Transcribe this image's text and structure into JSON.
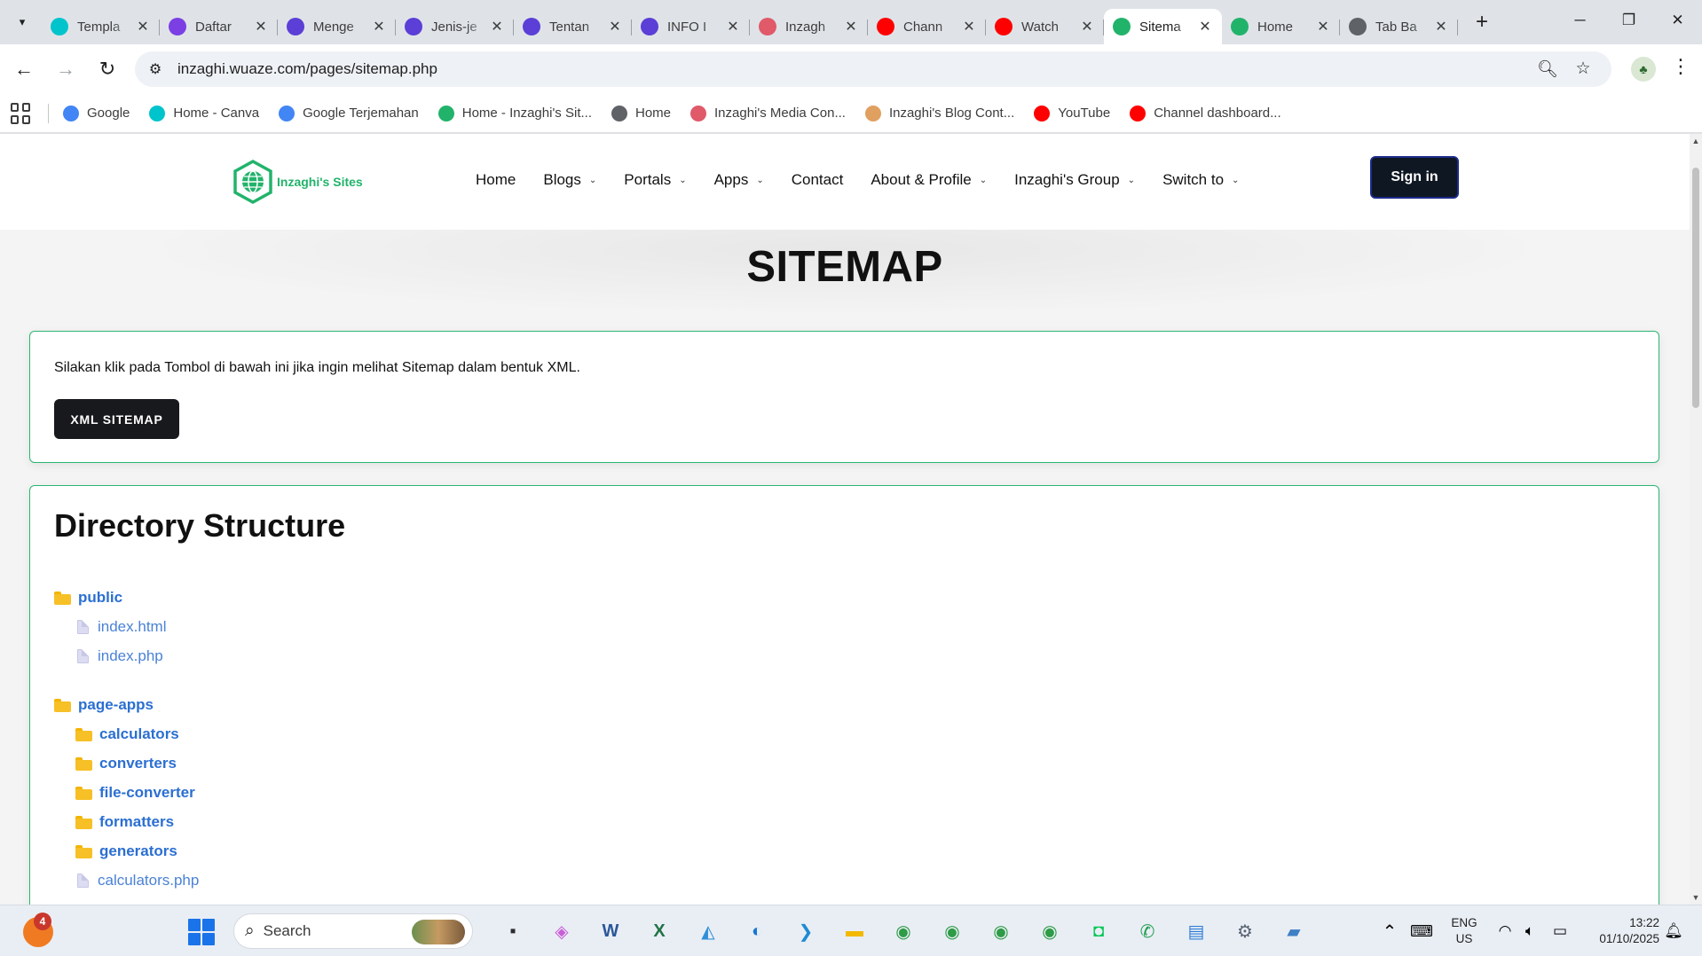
{
  "browser": {
    "tabs": [
      {
        "title": "Templa",
        "icon": "canva-icon",
        "color": "#00c4cc"
      },
      {
        "title": "Daftar",
        "icon": "video-icon",
        "color": "#7b3fe4"
      },
      {
        "title": "Menge",
        "icon": "shield-heart-icon",
        "color": "#5b3fd6"
      },
      {
        "title": "Jenis-je",
        "icon": "shield-heart-icon",
        "color": "#5b3fd6"
      },
      {
        "title": "Tentan",
        "icon": "shield-heart-icon",
        "color": "#5b3fd6"
      },
      {
        "title": "INFO I",
        "icon": "shield-heart-icon",
        "color": "#5b3fd6"
      },
      {
        "title": "Inzagh",
        "icon": "media-icon",
        "color": "#e05a6a"
      },
      {
        "title": "Chann",
        "icon": "youtube-icon",
        "color": "#ff0000"
      },
      {
        "title": "Watch",
        "icon": "youtube-icon",
        "color": "#ff0000"
      },
      {
        "title": "Sitema",
        "icon": "globe-icon",
        "color": "#22b36b",
        "active": true
      },
      {
        "title": "Home",
        "icon": "globe-icon",
        "color": "#22b36b"
      },
      {
        "title": "Tab Ba",
        "icon": "chrome-icon",
        "color": "#5f6368"
      }
    ],
    "url": "inzaghi.wuaze.com/pages/sitemap.php",
    "bookmarks": [
      {
        "label": "Google",
        "color": "#4285f4"
      },
      {
        "label": "Home - Canva",
        "color": "#00c4cc"
      },
      {
        "label": "Google Terjemahan",
        "color": "#4285f4"
      },
      {
        "label": "Home - Inzaghi's Sit...",
        "color": "#22b36b"
      },
      {
        "label": "Home",
        "color": "#5f6368"
      },
      {
        "label": "Inzaghi's Media Con...",
        "color": "#e05a6a"
      },
      {
        "label": "Inzaghi's Blog Cont...",
        "color": "#e0a060"
      },
      {
        "label": "YouTube",
        "color": "#ff0000"
      },
      {
        "label": "Channel dashboard...",
        "color": "#ff0000"
      }
    ]
  },
  "site": {
    "brand": "Inzaghi's Sites",
    "nav": [
      {
        "label": "Home",
        "dropdown": false
      },
      {
        "label": "Blogs",
        "dropdown": true
      },
      {
        "label": "Portals",
        "dropdown": true
      },
      {
        "label": "Apps",
        "dropdown": true
      },
      {
        "label": "Contact",
        "dropdown": false
      },
      {
        "label": "About & Profile",
        "dropdown": true
      },
      {
        "label": "Inzaghi's Group",
        "dropdown": true
      },
      {
        "label": "Switch to",
        "dropdown": true
      }
    ],
    "signin_label": "Sign in",
    "accent": "#2bb673"
  },
  "page": {
    "title": "SITEMAP",
    "xml_card": {
      "text": "Silakan klik pada Tombol di bawah ini jika ingin melihat Sitemap dalam bentuk XML.",
      "button": "XML SITEMAP"
    },
    "directory": {
      "title": "Directory Structure",
      "tree": [
        {
          "type": "folder",
          "name": "public",
          "depth": 0,
          "group": 0
        },
        {
          "type": "file",
          "name": "index.html",
          "depth": 1,
          "group": 0
        },
        {
          "type": "file",
          "name": "index.php",
          "depth": 1,
          "group": 0
        },
        {
          "type": "folder",
          "name": "page-apps",
          "depth": 0,
          "group": 1
        },
        {
          "type": "folder",
          "name": "calculators",
          "depth": 1,
          "group": 1
        },
        {
          "type": "folder",
          "name": "converters",
          "depth": 1,
          "group": 1
        },
        {
          "type": "folder",
          "name": "file-converter",
          "depth": 1,
          "group": 1
        },
        {
          "type": "folder",
          "name": "formatters",
          "depth": 1,
          "group": 1
        },
        {
          "type": "folder",
          "name": "generators",
          "depth": 1,
          "group": 1
        },
        {
          "type": "file",
          "name": "calculators.php",
          "depth": 1,
          "group": 1
        }
      ]
    }
  },
  "taskbar": {
    "weather_badge": "4",
    "search_label": "Search",
    "lang_top": "ENG",
    "lang_bottom": "US",
    "time": "13:22",
    "date": "01/10/2025",
    "apps": [
      "file-manager-icon",
      "copilot-icon",
      "word-icon",
      "excel-icon",
      "photos-icon",
      "edge-icon",
      "vscode-icon",
      "explorer-icon",
      "chrome-icon",
      "chrome-icon",
      "chrome-icon",
      "chrome-icon",
      "line-icon",
      "whatsapp-icon",
      "notepad-icon",
      "settings-icon",
      "network-drive-icon"
    ]
  }
}
